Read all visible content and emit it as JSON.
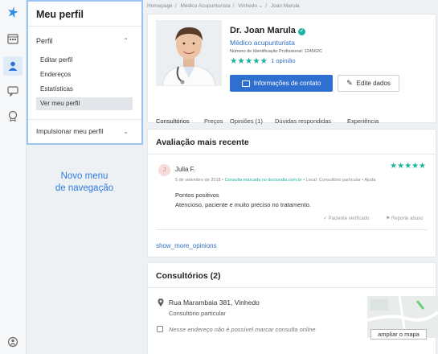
{
  "sidebar_menu": {
    "title": "Meu perfil",
    "group_label": "Perfil",
    "items": [
      {
        "label": "Editar perfil"
      },
      {
        "label": "Endereços"
      },
      {
        "label": "Estatísticas"
      },
      {
        "label": "Ver meu perfil"
      }
    ],
    "promote_label": "Impulsionar meu perfil"
  },
  "annotation": {
    "line1": "Novo menu",
    "line2": "de navegação"
  },
  "breadcrumb": [
    "Homepage",
    "Médico Acupunturista",
    "Vinhedo",
    "Joan Marula"
  ],
  "profile": {
    "name": "Dr. Joan Marula",
    "specialty": "Médico acupunturista",
    "registration": "Número de Identificação Profissional: 124562C",
    "stars": "★★★★★",
    "opinion_count": "1 opinião",
    "contact_button": "Informações de contato",
    "edit_button": "Edite dados"
  },
  "tabs": [
    {
      "label": "Consultórios"
    },
    {
      "label": "Preços"
    },
    {
      "label": "Opiniões (1)"
    },
    {
      "label": "Dúvidas respondidas"
    },
    {
      "label": "Experiência"
    }
  ],
  "latest_review": {
    "section_title": "Avaliação mais recente",
    "avatar_initial": "J",
    "reviewer": "Julia F.",
    "stars": "★★★★★",
    "date": "5 de setembro de 2018",
    "source": "Consulta marcada no doctoralia.com.br",
    "place": "Local: Consultório particular",
    "heading": "Pontos positivos",
    "body": "Atencioso, paciente e muito preciso no tratamento.",
    "verified": "Paciente verificado",
    "report": "Reporte abuso",
    "show_more": "show_more_opinions"
  },
  "offices": {
    "section_title": "Consultórios (2)",
    "address": "Rua Marambaia 381, Vinhedo",
    "address_type": "Consultório particular",
    "warning": "Nesse endereço não é possível marcar consulta online",
    "map_button": "ampliar o mapa"
  },
  "colors": {
    "accent": "#2e6fd0",
    "stars": "#1bb3a0",
    "annotation": "#2e7be0",
    "menu_border": "#9dc3f0"
  },
  "icons": {
    "logo": "doctoralia-star-logo",
    "calendar": "calendar-icon",
    "profile": "user-profile-icon",
    "messages": "chat-icon",
    "badge": "badge-icon",
    "help": "help-icon"
  }
}
